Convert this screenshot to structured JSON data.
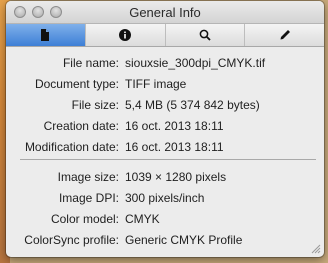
{
  "window": {
    "title": "General Info"
  },
  "toolbar": {
    "tabs": [
      {
        "icon": "document-icon",
        "active": true
      },
      {
        "icon": "info-icon",
        "active": false
      },
      {
        "icon": "magnifier-icon",
        "active": false
      },
      {
        "icon": "pen-icon",
        "active": false
      }
    ]
  },
  "file_info": [
    {
      "label": "File name:",
      "value": "siouxsie_300dpi_CMYK.tif"
    },
    {
      "label": "Document type:",
      "value": "TIFF image"
    },
    {
      "label": "File size:",
      "value": "5,4 MB (5 374 842 bytes)"
    },
    {
      "label": "Creation date:",
      "value": "16 oct. 2013 18:11"
    },
    {
      "label": "Modification date:",
      "value": "16 oct. 2013 18:11"
    }
  ],
  "image_info": [
    {
      "label": "Image size:",
      "value": "1039 × 1280 pixels"
    },
    {
      "label": "Image DPI:",
      "value": "300 pixels/inch"
    },
    {
      "label": "Color model:",
      "value": "CMYK"
    },
    {
      "label": "ColorSync profile:",
      "value": "Generic CMYK Profile"
    }
  ],
  "colors": {
    "active_tab": "#3d7fd6",
    "window_bg": "#ececec"
  }
}
